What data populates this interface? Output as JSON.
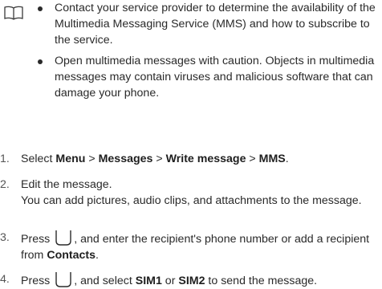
{
  "note": {
    "icon": "book-icon",
    "items": [
      "Contact your service provider to determine the availability of the Multimedia Messaging Service (MMS) and how to subscribe to the service.",
      "Open multimedia messages with caution. Objects in multimedia messages may contain viruses and malicious software that can damage your phone."
    ]
  },
  "steps": {
    "s1": {
      "num": "1.",
      "pre": "Select ",
      "menu": "Menu",
      "sep1": " > ",
      "messages": "Messages",
      "sep2": " > ",
      "write": "Write message",
      "sep3": " > ",
      "mms": "MMS",
      "post": "."
    },
    "s2": {
      "num": "2.",
      "line1": "Edit the message.",
      "line2": "You can add pictures, audio clips, and attachments to the message."
    },
    "s3": {
      "num": "3.",
      "pre": "Press ",
      "mid": ", and enter the recipient's phone number or add a recipient from ",
      "contacts": "Contacts",
      "post": "."
    },
    "s4": {
      "num": "4.",
      "pre": "Press ",
      "mid": ", and select ",
      "sim1": "SIM1",
      "or": " or ",
      "sim2": "SIM2",
      "post": " to send the message."
    }
  },
  "icons": {
    "softkey": "softkey-icon"
  }
}
